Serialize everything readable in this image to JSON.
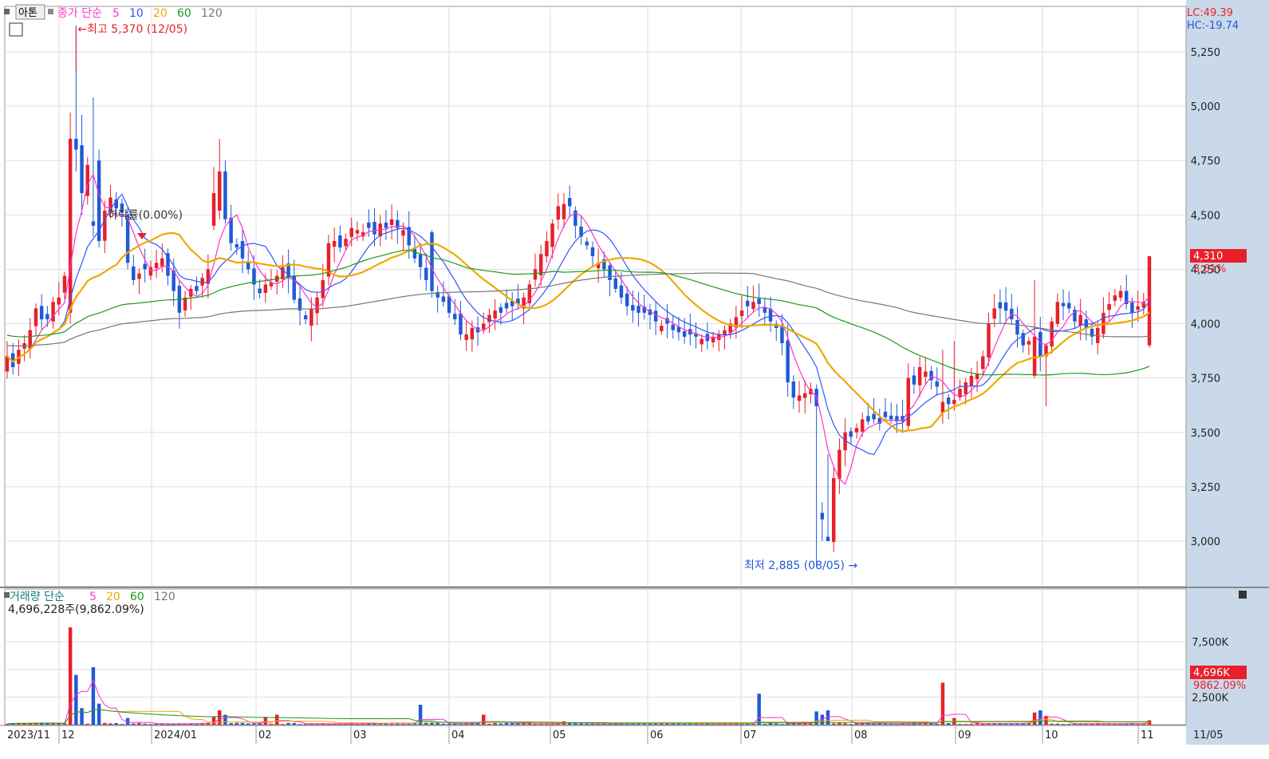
{
  "legend": {
    "price_prefix": "아톤",
    "price_label": "종가 단순",
    "ma_periods": [
      "5",
      "10",
      "20",
      "60",
      "120"
    ],
    "volume_label": "거래량 단순",
    "volume_periods": [
      "5",
      "20",
      "60",
      "120"
    ]
  },
  "lc_hc": {
    "lc": "LC:49.39",
    "hc": "HC:-19.74"
  },
  "annotations": {
    "high": "←최고 5,370 (12/05)",
    "low": "최저 2,885 (08/05) →",
    "drop": "하락률(0.00%)",
    "volume_info": "4,696,228주(9,862.09%)"
  },
  "current": {
    "price": "4,310",
    "pct": "3.61%",
    "volume": "4,696K",
    "volume_pct": "9862.09%"
  },
  "colors": {
    "up": "#e8202a",
    "down": "#1f5ad6",
    "ma5": "#ff33cc",
    "ma10": "#3355ff",
    "ma20": "#f0a800",
    "ma60": "#1a9a1a",
    "ma120": "#777777",
    "axis_bg": "#c9d9ea",
    "grid": "#dddddd"
  },
  "chart_data": {
    "type": "candlestick",
    "title": "아톤",
    "price_axis": {
      "ticks": [
        "3,000",
        "3,250",
        "3,500",
        "3,750",
        "4,000",
        "4,250",
        "4,500",
        "4,750",
        "5,000",
        "5,250"
      ]
    },
    "volume_axis": {
      "ticks": [
        "2,500K",
        "5,000K",
        "7,500K"
      ]
    },
    "x_ticks": [
      "2023/11",
      "12",
      "2024/01",
      "02",
      "03",
      "04",
      "05",
      "06",
      "07",
      "08",
      "09",
      "10",
      "11",
      "11/05"
    ],
    "high": {
      "value": 5370,
      "date": "12/05"
    },
    "low": {
      "value": 2885,
      "date": "08/05"
    },
    "last_close": 4310,
    "candle_count": 246,
    "closes": [
      3850,
      3800,
      3880,
      3910,
      3970,
      4070,
      4020,
      4020,
      4100,
      4120,
      4220,
      4850,
      4800,
      4600,
      4730,
      4450,
      4380,
      4520,
      4580,
      4530,
      4510,
      4280,
      4200,
      4230,
      4250,
      4260,
      4280,
      4300,
      4220,
      4150,
      4050,
      4120,
      4160,
      4150,
      4210,
      4250,
      4600,
      4700,
      4480,
      4370,
      4350,
      4300,
      4250,
      4180,
      4140,
      4180,
      4190,
      4220,
      4260,
      4210,
      4110,
      4060,
      4020,
      4070,
      4120,
      4200,
      4370,
      4380,
      4350,
      4390,
      4440,
      4430,
      4420,
      4440,
      4410,
      4460,
      4440,
      4480,
      4440,
      4430,
      4360,
      4300,
      4260,
      4200,
      4150,
      4120,
      4100,
      4050,
      4020,
      3950,
      3950,
      3980,
      3960,
      4000,
      4040,
      4060,
      4050,
      4070,
      4080,
      4090,
      4120,
      4180,
      4250,
      4320,
      4380,
      4460,
      4540,
      4550,
      4540,
      4450,
      4400,
      4360,
      4310,
      4280,
      4250,
      4200,
      4160,
      4120,
      4080,
      4060,
      4050,
      4050,
      4040,
      4010,
      3990,
      4000,
      3970,
      3960,
      3940,
      3950,
      3940,
      3930,
      3920,
      3940,
      3950,
      3970,
      4000,
      4030,
      4060,
      4080,
      4100,
      4090,
      4050,
      4010,
      3980,
      3910,
      3730,
      3660,
      3670,
      3680,
      3700,
      3620,
      3100,
      3000,
      3290,
      3420,
      3500,
      3480,
      3520,
      3560,
      3550,
      3560,
      3540,
      3570,
      3560,
      3550,
      3550,
      3750,
      3720,
      3800,
      3780,
      3740,
      3710,
      3640,
      3630,
      3650,
      3700,
      3730,
      3760,
      3770,
      3850,
      4000,
      4070,
      4070,
      4060,
      4020,
      3950,
      3900,
      3920,
      3940,
      3850,
      3900,
      4010,
      4100,
      4080,
      4070,
      4010,
      4040,
      3980,
      3940,
      3980,
      4050,
      4090,
      4130,
      4150,
      4090,
      4050,
      4080,
      4100,
      4310
    ],
    "ma_lines": [
      "MA5",
      "MA10",
      "MA20",
      "MA60",
      "MA120"
    ]
  }
}
